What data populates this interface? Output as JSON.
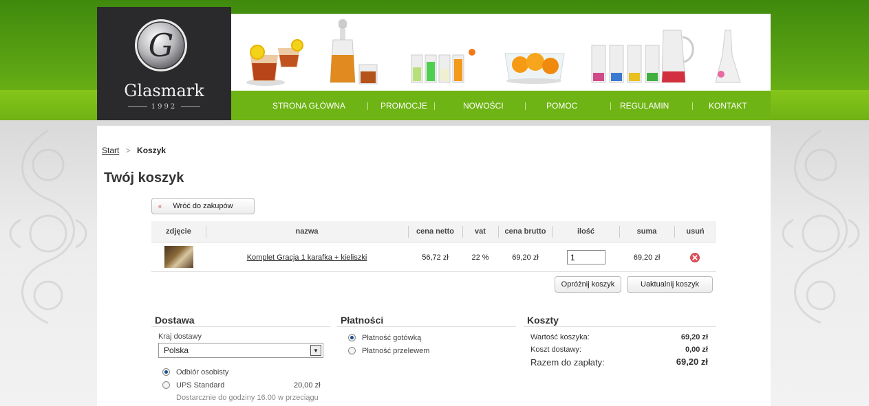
{
  "brand": {
    "name": "Glasmark",
    "year": "1992",
    "emblem_letter": "G"
  },
  "nav": {
    "items": [
      "STRONA GŁÓWNA",
      "PROMOCJE",
      "NOWOŚCI",
      "POMOC",
      "REGULAMIN",
      "KONTAKT"
    ]
  },
  "breadcrumb": {
    "start": "Start",
    "current": "Koszyk"
  },
  "page_title": "Twój koszyk",
  "back_button": "Wróć do zakupów",
  "table": {
    "headers": [
      "zdjęcie",
      "nazwa",
      "cena netto",
      "vat",
      "cena brutto",
      "ilość",
      "suma",
      "usuń"
    ],
    "rows": [
      {
        "name": "Komplet Gracja 1 karafka + kieliszki",
        "net_price": "56,72 zł",
        "vat": "22 %",
        "gross_price": "69,20 zł",
        "quantity": "1",
        "sum": "69,20 zł"
      }
    ]
  },
  "buttons": {
    "empty_cart": "Opróżnij koszyk",
    "update_cart": "Uaktualnij koszyk"
  },
  "delivery": {
    "title": "Dostawa",
    "country_label": "Kraj dostawy",
    "country_value": "Polska",
    "options": [
      {
        "label": "Odbiór osobisty",
        "price": "",
        "selected": true
      },
      {
        "label": "UPS Standard",
        "price": "20,00 zł",
        "selected": false
      }
    ],
    "note": "Dostarcznie do godziny 16.00 w przeciągu"
  },
  "payment": {
    "title": "Płatności",
    "options": [
      {
        "label": "Płatność gotówką",
        "selected": true
      },
      {
        "label": "Płatność przelewem",
        "selected": false
      }
    ]
  },
  "costs": {
    "title": "Koszty",
    "cart_value_label": "Wartość koszyka:",
    "cart_value": "69,20 zł",
    "delivery_cost_label": "Koszt dostawy:",
    "delivery_cost": "0,00 zł",
    "total_label": "Razem do zapłaty:",
    "total": "69,20 zł"
  },
  "colors": {
    "brand_green": "#6eb414",
    "logo_bg": "#2a2a2c",
    "remove_red": "#e0505a"
  }
}
